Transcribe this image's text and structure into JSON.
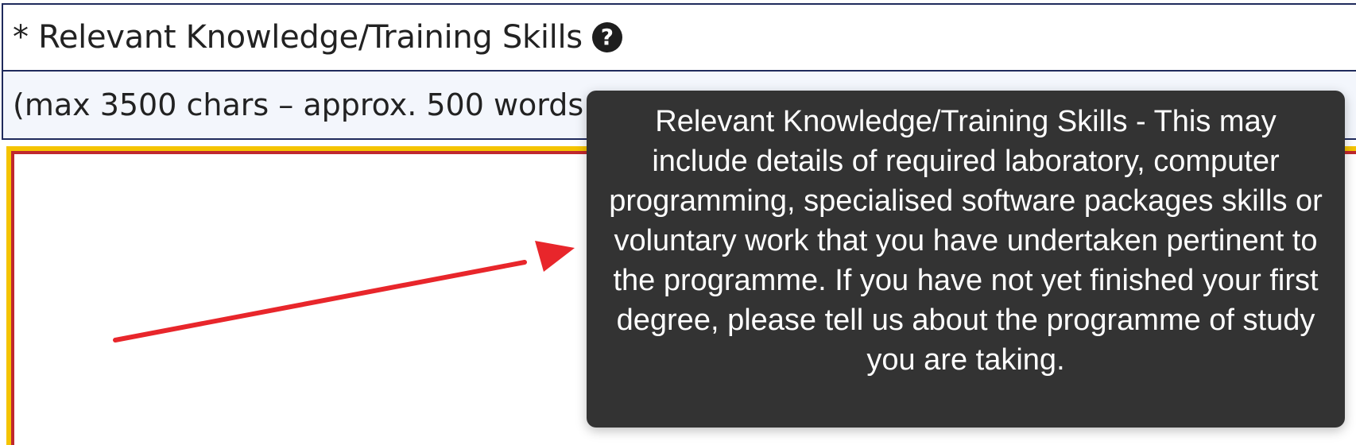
{
  "field": {
    "required_marker": "*",
    "label": "Relevant Knowledge/Training Skills",
    "help_icon_glyph": "?",
    "hint": "(max 3500 chars – approx. 500 words",
    "textarea_value": ""
  },
  "tooltip": {
    "text": "Relevant Knowledge/Training Skills - This may include details of required laboratory, computer programming, specialised software packages skills or voluntary work that you have undertaken pertinent to the programme. If you have not yet finished your first degree, please tell us about the programme of study you are taking."
  },
  "colors": {
    "border": "#1f2a5c",
    "hint_background": "#f3f6fc",
    "focus_outline": "#f5c400",
    "invalid_border": "#c0282e",
    "tooltip_background": "#333333",
    "annotation_arrow": "#e8262b"
  },
  "icons": {
    "help": "question-circle-icon"
  }
}
